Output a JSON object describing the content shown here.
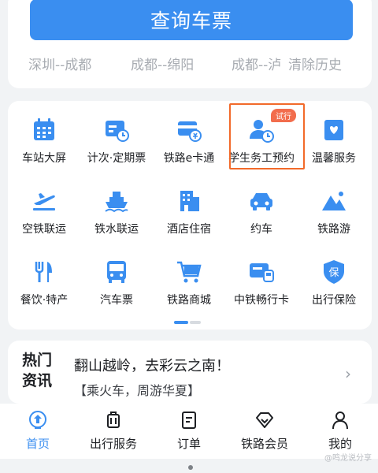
{
  "search": {
    "query_button": "查询车票",
    "history": [
      "深圳--成都",
      "成都--绵阳",
      "成都--泸",
      "清除历史"
    ]
  },
  "services": [
    {
      "label": "车站大屏",
      "icon": "station-screen-icon"
    },
    {
      "label": "计次·定期票",
      "icon": "ticket-calendar-icon"
    },
    {
      "label": "铁路e卡通",
      "icon": "e-card-icon"
    },
    {
      "label": "学生务工预约",
      "icon": "student-worker-icon",
      "badge": "试行"
    },
    {
      "label": "温馨服务",
      "icon": "heart-box-icon"
    },
    {
      "label": "空铁联运",
      "icon": "plane-icon"
    },
    {
      "label": "铁水联运",
      "icon": "ship-icon"
    },
    {
      "label": "酒店住宿",
      "icon": "hotel-icon"
    },
    {
      "label": "约车",
      "icon": "car-icon"
    },
    {
      "label": "铁路游",
      "icon": "mountain-icon"
    },
    {
      "label": "餐饮·特产",
      "icon": "cutlery-icon"
    },
    {
      "label": "汽车票",
      "icon": "bus-icon"
    },
    {
      "label": "铁路商城",
      "icon": "cart-icon"
    },
    {
      "label": "中铁畅行卡",
      "icon": "card-train-icon"
    },
    {
      "label": "出行保险",
      "icon": "insurance-shield-icon"
    }
  ],
  "news": {
    "tag_line1": "热门",
    "tag_line2": "资讯",
    "title": "翻山越岭，去彩云之南！",
    "subtitle": "【乘火车，周游华夏】"
  },
  "tabs": [
    {
      "label": "首页",
      "icon": "home-train-icon",
      "active": true
    },
    {
      "label": "出行服务",
      "icon": "luggage-icon",
      "active": false
    },
    {
      "label": "订单",
      "icon": "order-doc-icon",
      "active": false
    },
    {
      "label": "铁路会员",
      "icon": "diamond-icon",
      "active": false
    },
    {
      "label": "我的",
      "icon": "user-icon",
      "active": false
    }
  ],
  "watermark": "@鸣龙说分享",
  "colors": {
    "accent": "#3a8ef0",
    "highlight": "#f26a2a",
    "badge": "#f26d4d"
  }
}
